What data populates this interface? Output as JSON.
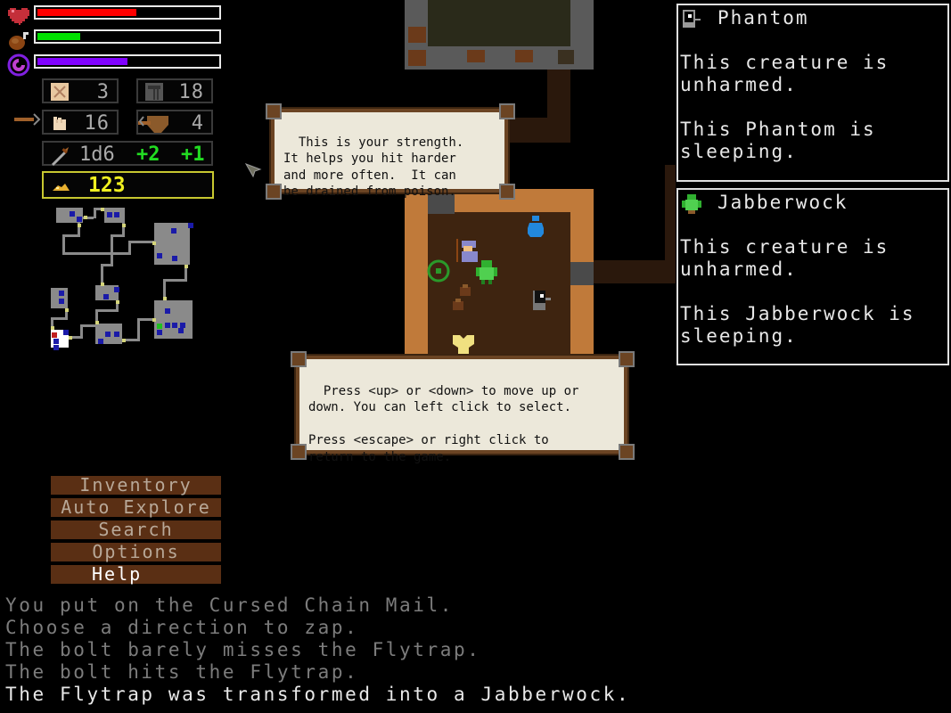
{
  "status": {
    "health": {
      "icon": "heart-icon",
      "fraction": 0.55,
      "color": "#ff0000"
    },
    "food": {
      "icon": "meat-icon",
      "fraction": 0.24,
      "color": "#00e000"
    },
    "magic": {
      "icon": "magic-swirl-icon",
      "fraction": 0.5,
      "color": "#8000ff"
    }
  },
  "stats": {
    "depth": {
      "icon": "map-scroll-icon",
      "value": "3"
    },
    "turns": {
      "icon": "tower-icon",
      "value": "18"
    },
    "strength": {
      "icon": "fist-icon",
      "value": "16"
    },
    "armor": {
      "icon": "shield-icon",
      "value": "4"
    },
    "weapon": {
      "icon": "sword-icon",
      "damage": "1d6",
      "bonus_hit": "+2",
      "bonus_dmg": "+1"
    },
    "gold": {
      "icon": "gold-pile-icon",
      "value": "123"
    }
  },
  "tooltip_strength": "This is your strength.\nIt helps you hit harder\nand more often.  It can\nbe drained from poison.",
  "tooltip_help": "Press <up> or <down> to move up or\ndown. You can left click to select.\n\nPress <escape> or right click to\nreturn to the game.",
  "creatures": [
    {
      "name": "Phantom",
      "icon": "phantom-icon",
      "text": "This creature is\nunharmed.\n\nThis Phantom is\nsleeping."
    },
    {
      "name": "Jabberwock",
      "icon": "jabberwock-icon",
      "text": "This creature is\nunharmed.\n\nThis Jabberwock is\nsleeping."
    }
  ],
  "menu": [
    {
      "label": "Inventory",
      "active": false
    },
    {
      "label": "Auto Explore",
      "active": false
    },
    {
      "label": "Search",
      "active": false
    },
    {
      "label": "Options",
      "active": false
    },
    {
      "label": "Help",
      "active": true
    }
  ],
  "log": [
    "You put on the Cursed Chain Mail.",
    "Choose a direction to zap.",
    "The bolt barely misses the Flytrap.",
    "The bolt hits the Flytrap.",
    "The Flytrap was transformed into a Jabberwock."
  ]
}
